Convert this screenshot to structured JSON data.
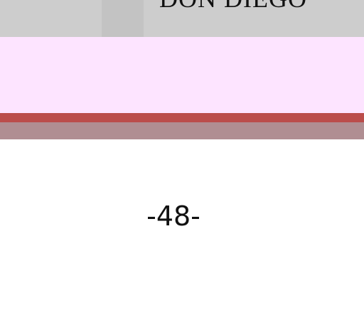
{
  "header": {
    "title_fragment": "DON DIEGO"
  },
  "footer": {
    "page_number": "-48-"
  },
  "colors": {
    "top_band": "#cdcdcd",
    "pink_band": "#fde4ff",
    "red_stripe": "#bb4d4b",
    "mauve_stripe": "#b08e92"
  }
}
